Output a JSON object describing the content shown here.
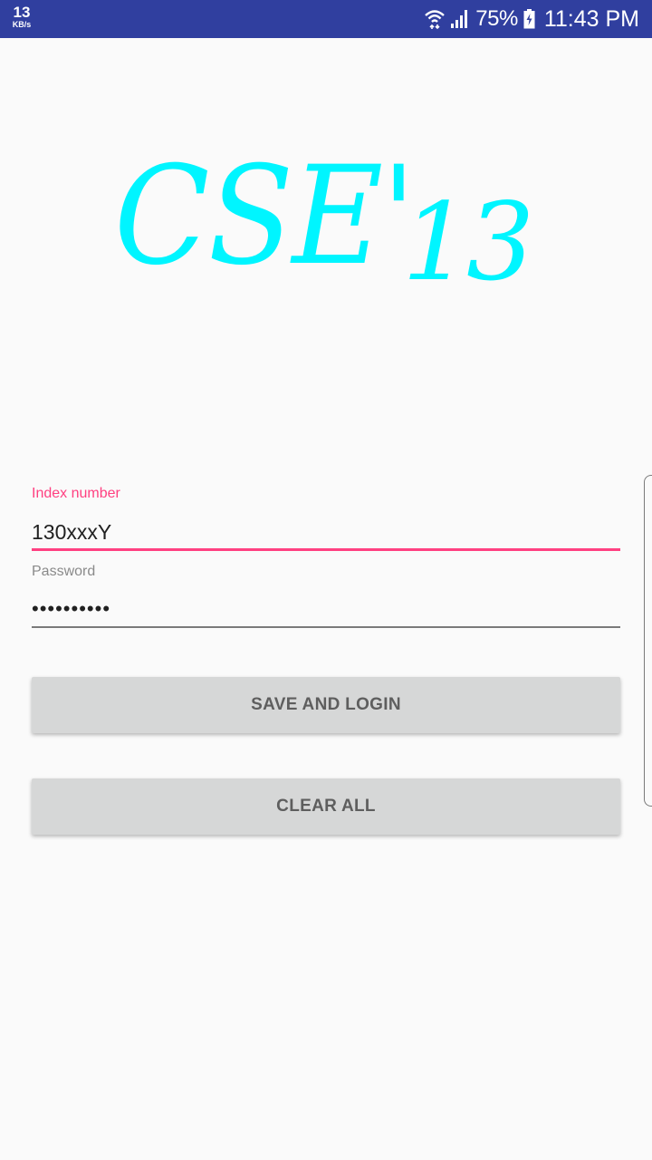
{
  "status_bar": {
    "speed_value": "13",
    "speed_unit": "KB/s",
    "battery": "75%",
    "time": "11:43 PM",
    "icons": [
      "wifi-icon",
      "signal-icon",
      "battery-charging-icon"
    ]
  },
  "logo": {
    "main": "CSE'",
    "sub": "13",
    "color": "#00f5ff"
  },
  "form": {
    "index": {
      "label": "Index number",
      "value": "130xxxY"
    },
    "password": {
      "label": "Password",
      "value": "••••••••••"
    }
  },
  "buttons": {
    "save_login": "SAVE AND LOGIN",
    "clear_all": "CLEAR ALL"
  },
  "colors": {
    "status_bar": "#303f9f",
    "accent": "#ff4081",
    "button_bg": "#d6d7d7",
    "background": "#fafafa"
  }
}
